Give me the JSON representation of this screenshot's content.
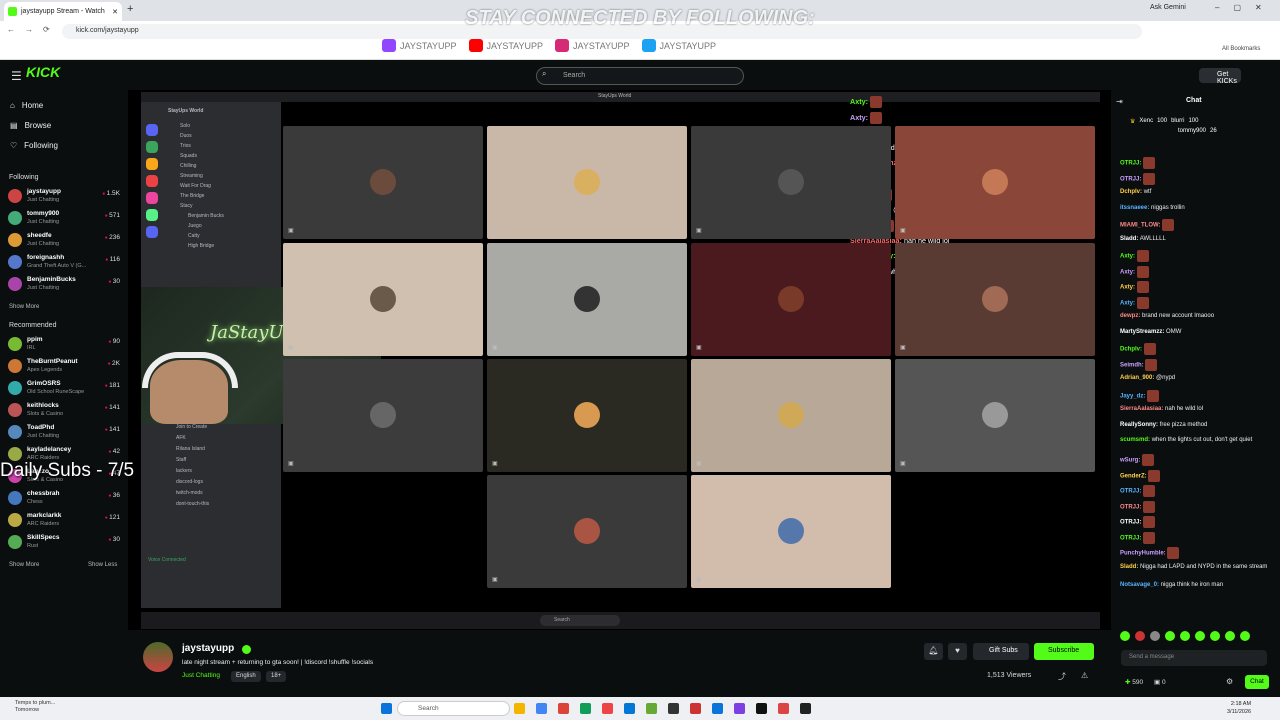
{
  "browser": {
    "tab_title": "jaystayupp Stream - Watch",
    "url": "kick.com/jaystayupp",
    "gemini": "Ask Gemini",
    "bookmarks": "All Bookmarks"
  },
  "overlay": {
    "banner": "STAY CONNECTED BY FOLLOWING:",
    "socials": [
      "JAYSTAYUPP",
      "JAYSTAYUPP",
      "JAYSTAYUPP",
      "JAYSTAYUPP"
    ],
    "daily_subs": "Daily Subs - 7/5",
    "neon": "JaStayUp"
  },
  "header": {
    "logo": "KICK",
    "search_placeholder": "Search",
    "get_kicks": "Get KICKs"
  },
  "sidebar": {
    "nav": [
      "Home",
      "Browse",
      "Following"
    ],
    "following_title": "Following",
    "following": [
      {
        "name": "jaystayupp",
        "game": "Just Chatting",
        "viewers": "1.5K"
      },
      {
        "name": "tommy900",
        "game": "Just Chatting",
        "viewers": "571"
      },
      {
        "name": "sheedfe",
        "game": "Just Chatting",
        "viewers": "236"
      },
      {
        "name": "foreignashh",
        "game": "Grand Theft Auto V (G...",
        "viewers": "116"
      },
      {
        "name": "BenjaminBucks",
        "game": "Just Chatting",
        "viewers": "30"
      }
    ],
    "show_more": "Show More",
    "recommended_title": "Recommended",
    "recommended": [
      {
        "name": "ppim",
        "game": "IRL",
        "viewers": "90"
      },
      {
        "name": "TheBurntPeanut",
        "game": "Apex Legends",
        "viewers": "2K"
      },
      {
        "name": "GrimOSRS",
        "game": "Old School RuneScape",
        "viewers": "181"
      },
      {
        "name": "keithlocks",
        "game": "Slots & Casino",
        "viewers": "141"
      },
      {
        "name": "ToadPhd",
        "game": "Just Chatting",
        "viewers": "141"
      },
      {
        "name": "kayladelancey",
        "game": "ARC Raiders",
        "viewers": "42"
      },
      {
        "name": "Lanzzo",
        "game": "Slots & Casino",
        "viewers": "47"
      },
      {
        "name": "chessbrah",
        "game": "Chess",
        "viewers": "36"
      },
      {
        "name": "markclarkk",
        "game": "ARC Raiders",
        "viewers": "121"
      },
      {
        "name": "SkillSpecs",
        "game": "Rust",
        "viewers": "30"
      }
    ],
    "show_less": "Show Less"
  },
  "discord": {
    "title": "StayUps World",
    "server": "StayUps World",
    "channels": [
      "Solo",
      "Duos",
      "Trios",
      "Squads",
      "Chilling",
      "Streaming",
      "Wait For Drag",
      "The Bridge",
      "Stacy",
      "Benjamin Bucks",
      "Juego",
      "Catty",
      "High Bridge"
    ],
    "lower": [
      "Join to Create",
      "AFK",
      "Rilana Island",
      "Staff",
      "lackers",
      "discord-logs",
      "twitch-mods",
      "dont-touch-this"
    ],
    "voice": "Voice Connected",
    "search": "Search"
  },
  "overlay_chat": [
    {
      "user": "Axty:",
      "text": ""
    },
    {
      "user": "Axty:",
      "text": ""
    },
    {
      "user": "Axty:",
      "text": ""
    },
    {
      "user": "dewpz:",
      "text": "brand new account lmaooo"
    },
    {
      "user": "MartyStreamzz:",
      "text": "OMW"
    },
    {
      "user": "Dchplv:",
      "text": ""
    },
    {
      "user": "Seimdh:",
      "text": ""
    },
    {
      "user": "Adrian_900:",
      "text": "@nypd"
    },
    {
      "user": "Jayy_dz:",
      "text": ""
    },
    {
      "user": "SierraAalasiaa:",
      "text": "nah he wild lol"
    },
    {
      "user": "ReallySonny:",
      "text": "free pizza method"
    },
    {
      "user": "scumsmd:",
      "text": "when the lights cut out, don't get quiet"
    }
  ],
  "chat": {
    "title": "Chat",
    "pinned": [
      {
        "user": "Xenc",
        "val": "100",
        "user2": "blurri",
        "val2": "100"
      },
      {
        "user": "tommy900",
        "val": "26"
      }
    ],
    "messages": [
      {
        "user": "OTRJJ:",
        "text": ""
      },
      {
        "user": "OTRJJ:",
        "text": ""
      },
      {
        "user": "Dchplv:",
        "text": "wtf"
      },
      {
        "user": "itssnaeee:",
        "text": "niggas trollin"
      },
      {
        "user": "MIAMI_TLOW:",
        "text": ""
      },
      {
        "user": "Sladd:",
        "text": "AWLLLLL"
      },
      {
        "user": "Axty:",
        "text": ""
      },
      {
        "user": "Axty:",
        "text": ""
      },
      {
        "user": "Axty:",
        "text": ""
      },
      {
        "user": "Axty:",
        "text": ""
      },
      {
        "user": "dewpz:",
        "text": "brand new account lmaooo"
      },
      {
        "user": "MartyStreamzz:",
        "text": "OMW"
      },
      {
        "user": "Dchplv:",
        "text": ""
      },
      {
        "user": "Seimdh:",
        "text": ""
      },
      {
        "user": "Adrian_900:",
        "text": "@nypd"
      },
      {
        "user": "Jayy_dz:",
        "text": ""
      },
      {
        "user": "SierraAalasiaa:",
        "text": "nah he wild lol"
      },
      {
        "user": "ReallySonny:",
        "text": "free pizza method"
      },
      {
        "user": "scumsmd:",
        "text": "when the lights cut out, don't get quiet"
      },
      {
        "user": "wSurg:",
        "text": ""
      },
      {
        "user": "GenderZ:",
        "text": ""
      },
      {
        "user": "OTRJJ:",
        "text": ""
      },
      {
        "user": "OTRJJ:",
        "text": ""
      },
      {
        "user": "OTRJJ:",
        "text": ""
      },
      {
        "user": "OTRJJ:",
        "text": ""
      },
      {
        "user": "PunchyHumble:",
        "text": ""
      },
      {
        "user": "Sladd:",
        "text": "Nigga had LAPD and NYPD in the same stream"
      },
      {
        "user": "Notsavage_0:",
        "text": "nigga think he iron man"
      }
    ],
    "input_placeholder": "Send a message",
    "points": "590",
    "points2": "0",
    "send": "Chat"
  },
  "stream_info": {
    "channel": "jaystayupp",
    "title": "late night stream + returning to gta soon! | !discord !shuffle !socials",
    "category": "Just Chatting",
    "tags": [
      "English",
      "18+"
    ],
    "gift_subs": "Gift Subs",
    "subscribe": "Subscribe",
    "viewers": "1,513 Viewers"
  },
  "taskbar": {
    "weather": "Temps to plum...",
    "weather2": "Tomorrow",
    "search": "Search",
    "time": "2:18 AM",
    "date": "3/11/2026"
  },
  "colors": {
    "accent": "#53fc18",
    "bg": "#0b0e0f"
  }
}
